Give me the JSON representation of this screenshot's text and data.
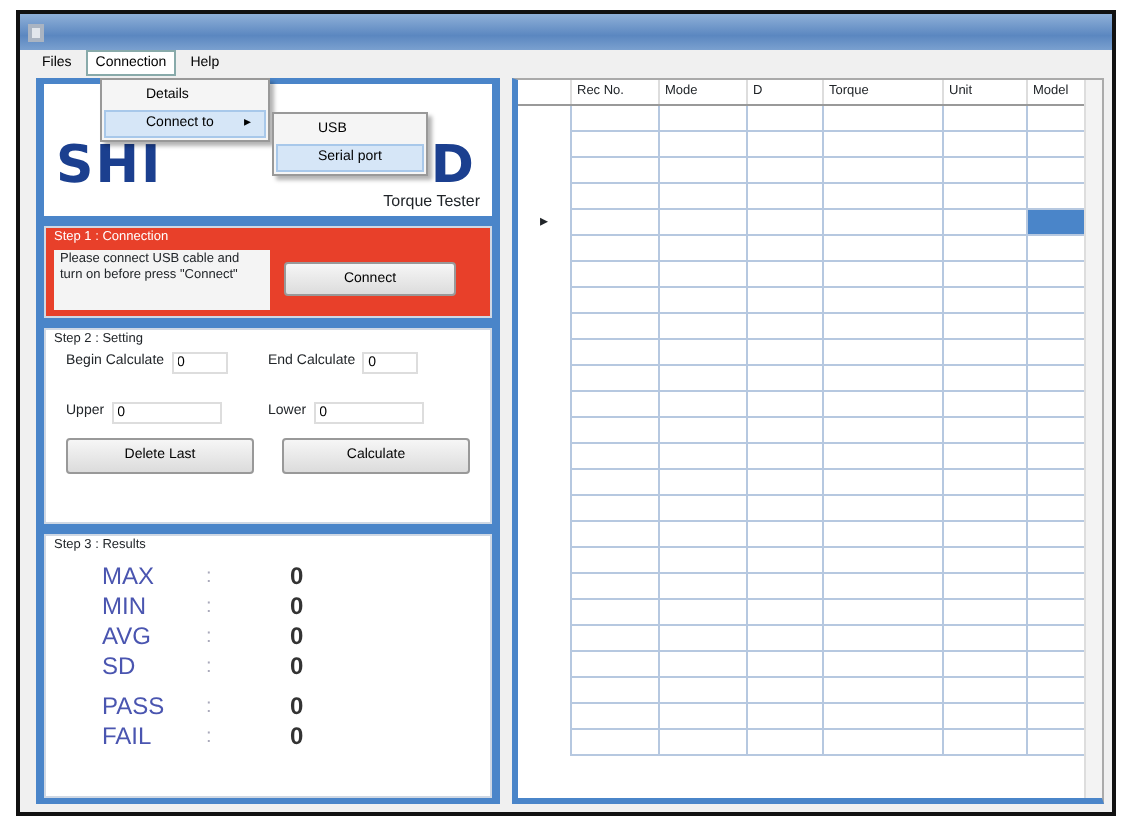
{
  "menu_bar": [
    {
      "label": "Files",
      "selected": false
    },
    {
      "label": "Connection",
      "selected": true
    },
    {
      "label": "Help",
      "selected": false
    }
  ],
  "connection_menu": [
    {
      "label": "Details",
      "selected": false
    },
    {
      "label": "Connect to",
      "selected": true,
      "arrow": "▸"
    }
  ],
  "connect_to_menu": [
    {
      "label": "USB",
      "selected": false
    },
    {
      "label": "Serial port",
      "selected": true
    }
  ],
  "logo": {
    "left": "SHI",
    "right": "D",
    "subtitle": "Torque Tester"
  },
  "step1": {
    "title": "Step 1 : Connection",
    "message": "Please connect USB cable and turn on before press \"Connect\"",
    "button": "Connect"
  },
  "step2": {
    "title": "Step 2 : Setting",
    "fields": [
      {
        "label": "Begin Calculate",
        "value": "0"
      },
      {
        "label": "End Calculate",
        "value": "0"
      },
      {
        "label": "Upper",
        "value": "0"
      },
      {
        "label": "Lower",
        "value": "0"
      }
    ],
    "buttons": [
      "Delete Last",
      "Calculate"
    ]
  },
  "step3": {
    "title": "Step 3 : Results",
    "results": [
      {
        "label": "MAX",
        "separator": ":",
        "value": "0"
      },
      {
        "label": "MIN",
        "separator": ":",
        "value": "0"
      },
      {
        "label": "AVG",
        "separator": ":",
        "value": "0"
      },
      {
        "label": "SD",
        "separator": ":",
        "value": "0"
      },
      {
        "label": "PASS",
        "separator": ":",
        "value": "0"
      },
      {
        "label": "FAIL",
        "separator": ":",
        "value": "0"
      }
    ]
  },
  "grid": {
    "columns": [
      "Rec No.",
      "Mode",
      "D",
      "Torque",
      "Unit",
      "Model"
    ],
    "current_marker": "▸",
    "rows": [
      {
        "current": false,
        "cell_selected": false
      },
      {
        "current": false,
        "cell_selected": false
      },
      {
        "current": false,
        "cell_selected": false
      },
      {
        "current": false,
        "cell_selected": false
      },
      {
        "current": true,
        "cell_selected": true
      },
      {
        "current": false,
        "cell_selected": false
      },
      {
        "current": false,
        "cell_selected": false
      },
      {
        "current": false,
        "cell_selected": false
      },
      {
        "current": false,
        "cell_selected": false
      },
      {
        "current": false,
        "cell_selected": false
      },
      {
        "current": false,
        "cell_selected": false
      },
      {
        "current": false,
        "cell_selected": false
      },
      {
        "current": false,
        "cell_selected": false
      },
      {
        "current": false,
        "cell_selected": false
      },
      {
        "current": false,
        "cell_selected": false
      },
      {
        "current": false,
        "cell_selected": false
      },
      {
        "current": false,
        "cell_selected": false
      },
      {
        "current": false,
        "cell_selected": false
      },
      {
        "current": false,
        "cell_selected": false
      },
      {
        "current": false,
        "cell_selected": false
      },
      {
        "current": false,
        "cell_selected": false
      },
      {
        "current": false,
        "cell_selected": false
      },
      {
        "current": false,
        "cell_selected": false
      },
      {
        "current": false,
        "cell_selected": false
      },
      {
        "current": false,
        "cell_selected": false
      }
    ]
  }
}
